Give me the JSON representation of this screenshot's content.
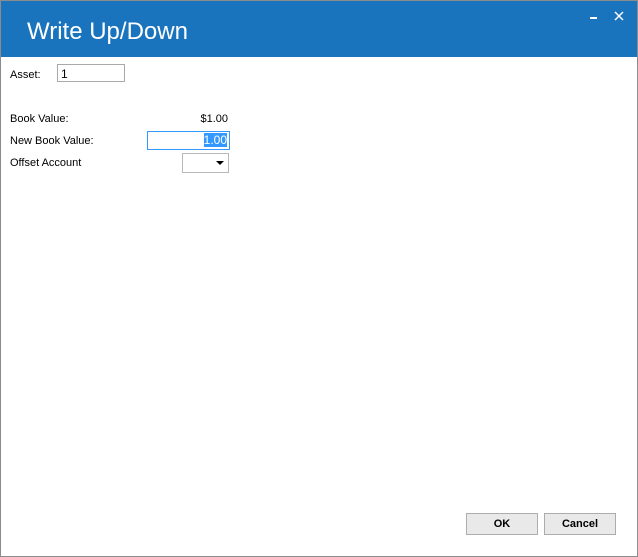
{
  "window": {
    "title": "Write Up/Down",
    "title_bar_color": "#1a74bd",
    "minimize_icon": "minimize-icon",
    "close_icon": "close-icon"
  },
  "form": {
    "asset_label": "Asset:",
    "asset_value": "1",
    "book_value_label": "Book Value:",
    "book_value": "$1.00",
    "new_book_value_label": "New  Book Value:",
    "new_book_value": "1.00",
    "offset_account_label": "Offset Account",
    "offset_account_value": ""
  },
  "buttons": {
    "ok_label": "OK",
    "cancel_label": "Cancel"
  }
}
